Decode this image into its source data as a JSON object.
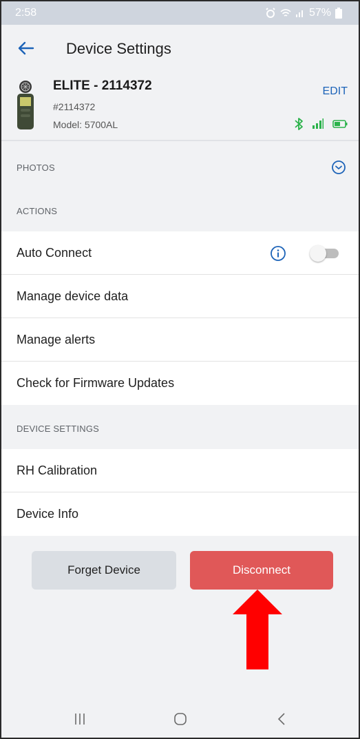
{
  "status_bar": {
    "time": "2:58",
    "battery_text": "57%"
  },
  "app_bar": {
    "title": "Device Settings"
  },
  "device": {
    "name": "ELITE - 2114372",
    "serial": "#2114372",
    "model": "Model: 5700AL",
    "edit_label": "EDIT"
  },
  "sections": {
    "photos_label": "PHOTOS",
    "actions_label": "ACTIONS",
    "device_settings_label": "DEVICE SETTINGS"
  },
  "actions": {
    "auto_connect": "Auto Connect",
    "auto_connect_enabled": false,
    "manage_data": "Manage device data",
    "manage_alerts": "Manage alerts",
    "firmware": "Check for Firmware Updates"
  },
  "device_settings": {
    "rh_calibration": "RH Calibration",
    "device_info": "Device Info"
  },
  "buttons": {
    "forget": "Forget Device",
    "disconnect": "Disconnect"
  },
  "colors": {
    "accent": "#1c63b8",
    "disconnect": "#e05858",
    "status_green": "#2ab24a",
    "annotation_arrow": "#ff0000"
  }
}
